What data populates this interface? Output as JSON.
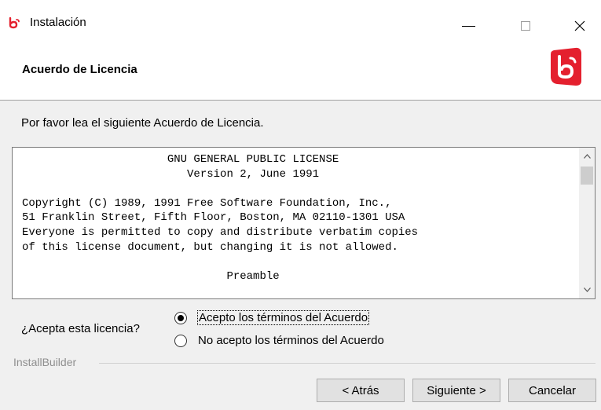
{
  "window": {
    "title": "Instalación",
    "app_icon": "bitnami-logo-icon",
    "controls": [
      "minimize-icon",
      "maximize-icon",
      "close-icon"
    ],
    "close_glyph": "✕"
  },
  "header": {
    "title": "Acuerdo de Licencia",
    "logo": "bitnami-logo-icon",
    "logo_color": "#e4202e"
  },
  "body": {
    "intro": "Por favor lea el siguiente Acuerdo de Licencia.",
    "license_text": "                      GNU GENERAL PUBLIC LICENSE\n                         Version 2, June 1991\n\nCopyright (C) 1989, 1991 Free Software Foundation, Inc.,\n51 Franklin Street, Fifth Floor, Boston, MA 02110-1301 USA\nEveryone is permitted to copy and distribute verbatim copies\nof this license document, but changing it is not allowed.\n\n                               Preamble",
    "question": "¿Acepta esta licencia?",
    "options": [
      {
        "label": "Acepto los términos del Acuerdo",
        "checked": true
      },
      {
        "label": "No acepto los términos del Acuerdo",
        "checked": false
      }
    ]
  },
  "footer": {
    "group_label": "InstallBuilder",
    "back_label": "< Atrás",
    "next_label": "Siguiente >",
    "cancel_label": "Cancelar"
  }
}
